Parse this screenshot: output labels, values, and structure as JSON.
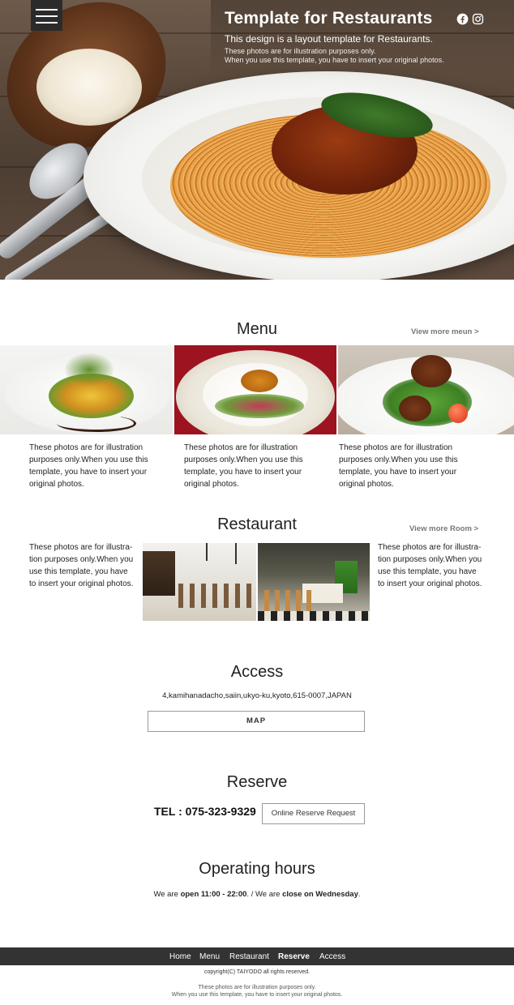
{
  "header": {
    "title": "Template for Restaurants",
    "subtitle": "This design is a layout template for Restaurants.",
    "note_line1": "These photos are for illustration purposes only.",
    "note_line2": "When you use this template, you have to insert your original photos.",
    "menu_icon": "hamburger-menu-icon",
    "social_icons": [
      "facebook-icon",
      "instagram-icon"
    ]
  },
  "menu": {
    "heading": "Menu",
    "more_link": "View more meun >",
    "items": [
      {
        "text": "These photos are for illustration purposes only.When you use this template, you have to insert your original photos."
      },
      {
        "text": "These photos are for illustration purposes only.When you use this template, you have to insert your original photos."
      },
      {
        "text": "These photos are for illustration purposes only.When you use this template, you have to insert your original photos."
      }
    ]
  },
  "restaurant": {
    "heading": "Restaurant",
    "more_link": "View more Room >",
    "left_text": "These photos are for illustra-tion purposes only.When you use this template, you have to insert your original photos.",
    "right_text": "These photos are for illustra-tion purposes only.When you use this template, you have to insert your original photos."
  },
  "access": {
    "heading": "Access",
    "address": "4,kamihanadacho,saiin,ukyo-ku,kyoto,615-0007,JAPAN",
    "map_button": "MAP"
  },
  "reserve": {
    "heading": "Reserve",
    "tel": "TEL : 075-323-9329",
    "request_button": "Online Reserve Request"
  },
  "hours": {
    "heading": "Operating hours",
    "prefix": "We are ",
    "open": "open 11:00 - 22:00",
    "middle": ". / We are ",
    "close": "close on Wednesday",
    "suffix": "."
  },
  "footer": {
    "nav": [
      "Home",
      "Menu",
      "Restaurant",
      "Reserve",
      "Access"
    ],
    "active": "Reserve",
    "copyright": "copyright(C) TAIYODO all rights reserved.",
    "note_line1": "These photos are for illustration purposes only.",
    "note_line2": "When you use this template, you have to insert your original photos."
  },
  "colors": {
    "footer_bar": "#333333",
    "header_button": "#2b2b2b",
    "link_gray": "#777777"
  }
}
